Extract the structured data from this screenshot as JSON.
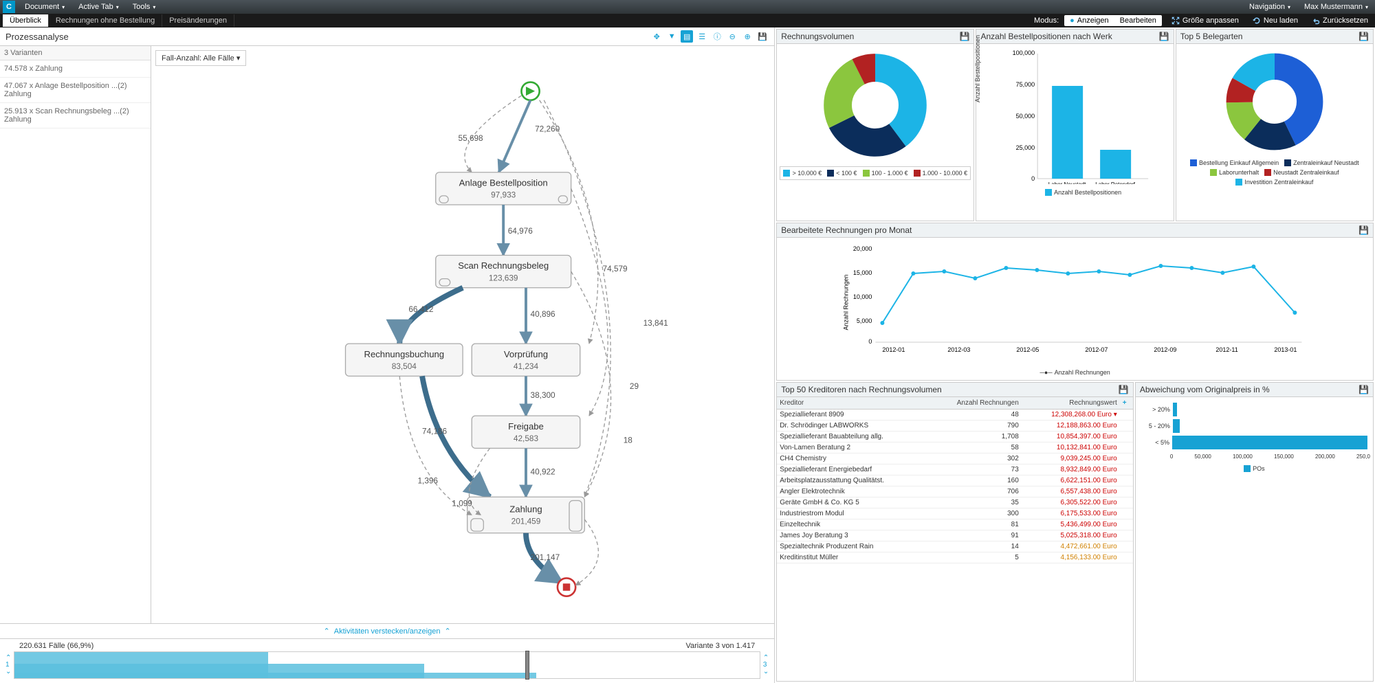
{
  "topbar": {
    "logo": "C",
    "menus": [
      "Document",
      "Active Tab",
      "Tools"
    ],
    "right": [
      "Navigation",
      "Max Mustermann"
    ]
  },
  "tabs": {
    "items": [
      "Überblick",
      "Rechnungen ohne Bestellung",
      "Preisänderungen"
    ],
    "mode_label": "Modus:",
    "mode_view": "Anzeigen",
    "mode_edit": "Bearbeiten",
    "fit": "Größe anpassen",
    "reload": "Neu laden",
    "reset": "Zurücksetzen"
  },
  "process": {
    "title": "Prozessanalyse",
    "variants_hdr": "3 Varianten",
    "variants": [
      "74.578 x Zahlung",
      "47.067 x Anlage Bestellposition ...(2) Zahlung",
      "25.913 x Scan Rechnungsbeleg ...(2) Zahlung"
    ],
    "case_dd": "Fall-Anzahl: Alle Fälle",
    "hide_act": "Aktivitäten verstecken/anzeigen",
    "slider_left": "220.631 Fälle (66,9%)",
    "slider_right": "Variante 3 von 1.417",
    "slider_l_num": "1",
    "slider_r_num": "3"
  },
  "nodes": {
    "n1": {
      "label": "Anlage Bestellposition",
      "sub": "97,933"
    },
    "n2": {
      "label": "Scan Rechnungsbeleg",
      "sub": "123,639"
    },
    "n3": {
      "label": "Rechnungsbuchung",
      "sub": "83,504"
    },
    "n4": {
      "label": "Vorprüfung",
      "sub": "41,234"
    },
    "n5": {
      "label": "Freigabe",
      "sub": "42,583"
    },
    "n6": {
      "label": "Zahlung",
      "sub": "201,459"
    }
  },
  "edges": {
    "e1": "72,260",
    "e2": "55,698",
    "e3": "64,976",
    "e4": "66,412",
    "e5": "40,896",
    "e6": "74,579",
    "e7": "38,300",
    "e8": "13,841",
    "e9": "74,186",
    "e10": "40,922",
    "e11": "1,396",
    "e12": "1,099",
    "e13": "201,147",
    "e14": "29",
    "e15": "18"
  },
  "rv": {
    "title": "Rechnungsvolumen",
    "legend": [
      "> 10.000 €",
      "< 100 €",
      "100 - 1.000 €",
      "1.000 - 10.000 €"
    ]
  },
  "bp": {
    "title": "Anzahl Bestellpositionen nach Werk",
    "ylabel": "Anzahl Bestellpositionen",
    "ymax": "100,000",
    "cats": [
      "Labor Neustadt",
      "Labor Rotendorf"
    ],
    "legend": "Anzahl Bestellpositionen"
  },
  "top5": {
    "title": "Top 5 Belegarten",
    "legend": [
      "Bestellung Einkauf Allgemein",
      "Zentraleinkauf Neustadt",
      "Laborunterhalt",
      "Neustadt Zentraleinkauf",
      "Investition Zentraleinkauf"
    ]
  },
  "monthly": {
    "title": "Bearbeitete Rechnungen pro Monat",
    "ylabel": "Anzahl Rechnungen",
    "legend": "Anzahl Rechnungen"
  },
  "kred": {
    "title": "Top 50 Kreditoren nach Rechnungsvolumen",
    "cols": [
      "Kreditor",
      "Anzahl Rechnungen",
      "Rechnungswert"
    ],
    "rows": [
      {
        "k": "Speziallieferant 8909",
        "a": "48",
        "w": "12,308,268.00 Euro",
        "c": "red",
        "arrow": true
      },
      {
        "k": "Dr. Schrödinger LABWORKS",
        "a": "790",
        "w": "12,188,863.00 Euro",
        "c": "red"
      },
      {
        "k": "Speziallieferant Bauabteilung allg.",
        "a": "1,708",
        "w": "10,854,397.00 Euro",
        "c": "red"
      },
      {
        "k": "Von-Lamen Beratung 2",
        "a": "58",
        "w": "10,132,841.00 Euro",
        "c": "red"
      },
      {
        "k": "CH4 Chemistry",
        "a": "302",
        "w": "9,039,245.00 Euro",
        "c": "red"
      },
      {
        "k": "Speziallieferant Energiebedarf",
        "a": "73",
        "w": "8,932,849.00 Euro",
        "c": "red"
      },
      {
        "k": "Arbeitsplatzausstattung Qualitätst.",
        "a": "160",
        "w": "6,622,151.00 Euro",
        "c": "red"
      },
      {
        "k": "Angler Elektrotechnik",
        "a": "706",
        "w": "6,557,438.00 Euro",
        "c": "red"
      },
      {
        "k": "Geräte GmbH & Co. KG 5",
        "a": "35",
        "w": "6,305,522.00 Euro",
        "c": "red"
      },
      {
        "k": "Industriestrom Modul",
        "a": "300",
        "w": "6,175,533.00 Euro",
        "c": "red"
      },
      {
        "k": "Einzeltechnik",
        "a": "81",
        "w": "5,436,499.00 Euro",
        "c": "red"
      },
      {
        "k": "James Joy Beratung 3",
        "a": "91",
        "w": "5,025,318.00 Euro",
        "c": "red"
      },
      {
        "k": "Spezialtechnik Produzent Rain",
        "a": "14",
        "w": "4,472,661.00 Euro",
        "c": "org"
      },
      {
        "k": "Kreditinstitut Müller",
        "a": "5",
        "w": "4,156,133.00 Euro",
        "c": "org"
      }
    ]
  },
  "dev": {
    "title": "Abweichung vom Originalpreis in %",
    "cats": [
      "> 20%",
      "5 - 20%",
      "< 5%"
    ],
    "xticks": [
      "0",
      "50,000",
      "100,000",
      "150,000",
      "200,000",
      "250,0"
    ],
    "legend": "POs"
  },
  "chart_data": {
    "rechnungsvolumen_donut": {
      "type": "pie",
      "title": "Rechnungsvolumen",
      "series": [
        {
          "name": "> 10.000 €",
          "value": 40,
          "color": "#1cb4e6"
        },
        {
          "name": "< 100 €",
          "value": 28,
          "color": "#0b2d5b"
        },
        {
          "name": "100 - 1.000 €",
          "value": 25,
          "color": "#8bc63e"
        },
        {
          "name": "1.000 - 10.000 €",
          "value": 7,
          "color": "#b22222"
        }
      ]
    },
    "bestellpositionen_bar": {
      "type": "bar",
      "title": "Anzahl Bestellpositionen nach Werk",
      "ylabel": "Anzahl Bestellpositionen",
      "ylim": [
        0,
        100000
      ],
      "categories": [
        "Labor Neustadt",
        "Labor Rotendorf"
      ],
      "values": [
        74000,
        23000
      ]
    },
    "top5_belegarten_donut": {
      "type": "pie",
      "title": "Top 5 Belegarten",
      "series": [
        {
          "name": "Bestellung Einkauf Allgemein",
          "value": 43,
          "color": "#1d5fd6"
        },
        {
          "name": "Zentraleinkauf Neustadt",
          "value": 18,
          "color": "#0b2d5b"
        },
        {
          "name": "Laborunterhalt",
          "value": 14,
          "color": "#8bc63e"
        },
        {
          "name": "Neustadt Zentraleinkauf",
          "value": 8,
          "color": "#b22222"
        },
        {
          "name": "Investition Zentraleinkauf",
          "value": 17,
          "color": "#1cb4e6"
        }
      ]
    },
    "monthly_line": {
      "type": "line",
      "title": "Bearbeitete Rechnungen pro Monat",
      "ylabel": "Anzahl Rechnungen",
      "ylim": [
        0,
        20000
      ],
      "x": [
        "2012-01",
        "2012-02",
        "2012-03",
        "2012-04",
        "2012-05",
        "2012-06",
        "2012-07",
        "2012-08",
        "2012-09",
        "2012-10",
        "2012-11",
        "2012-12",
        "2013-01",
        "2013-02"
      ],
      "values": [
        5000,
        14500,
        15000,
        13000,
        15800,
        15300,
        14500,
        15000,
        14200,
        16300,
        15800,
        14800,
        16200,
        6500
      ]
    },
    "abweichung_hbar": {
      "type": "bar",
      "orientation": "horizontal",
      "title": "Abweichung vom Originalpreis in %",
      "xlabel": "POs",
      "xlim": [
        0,
        250000
      ],
      "categories": [
        "> 20%",
        "5 - 20%",
        "< 5%"
      ],
      "values": [
        3000,
        6000,
        230000
      ]
    }
  }
}
